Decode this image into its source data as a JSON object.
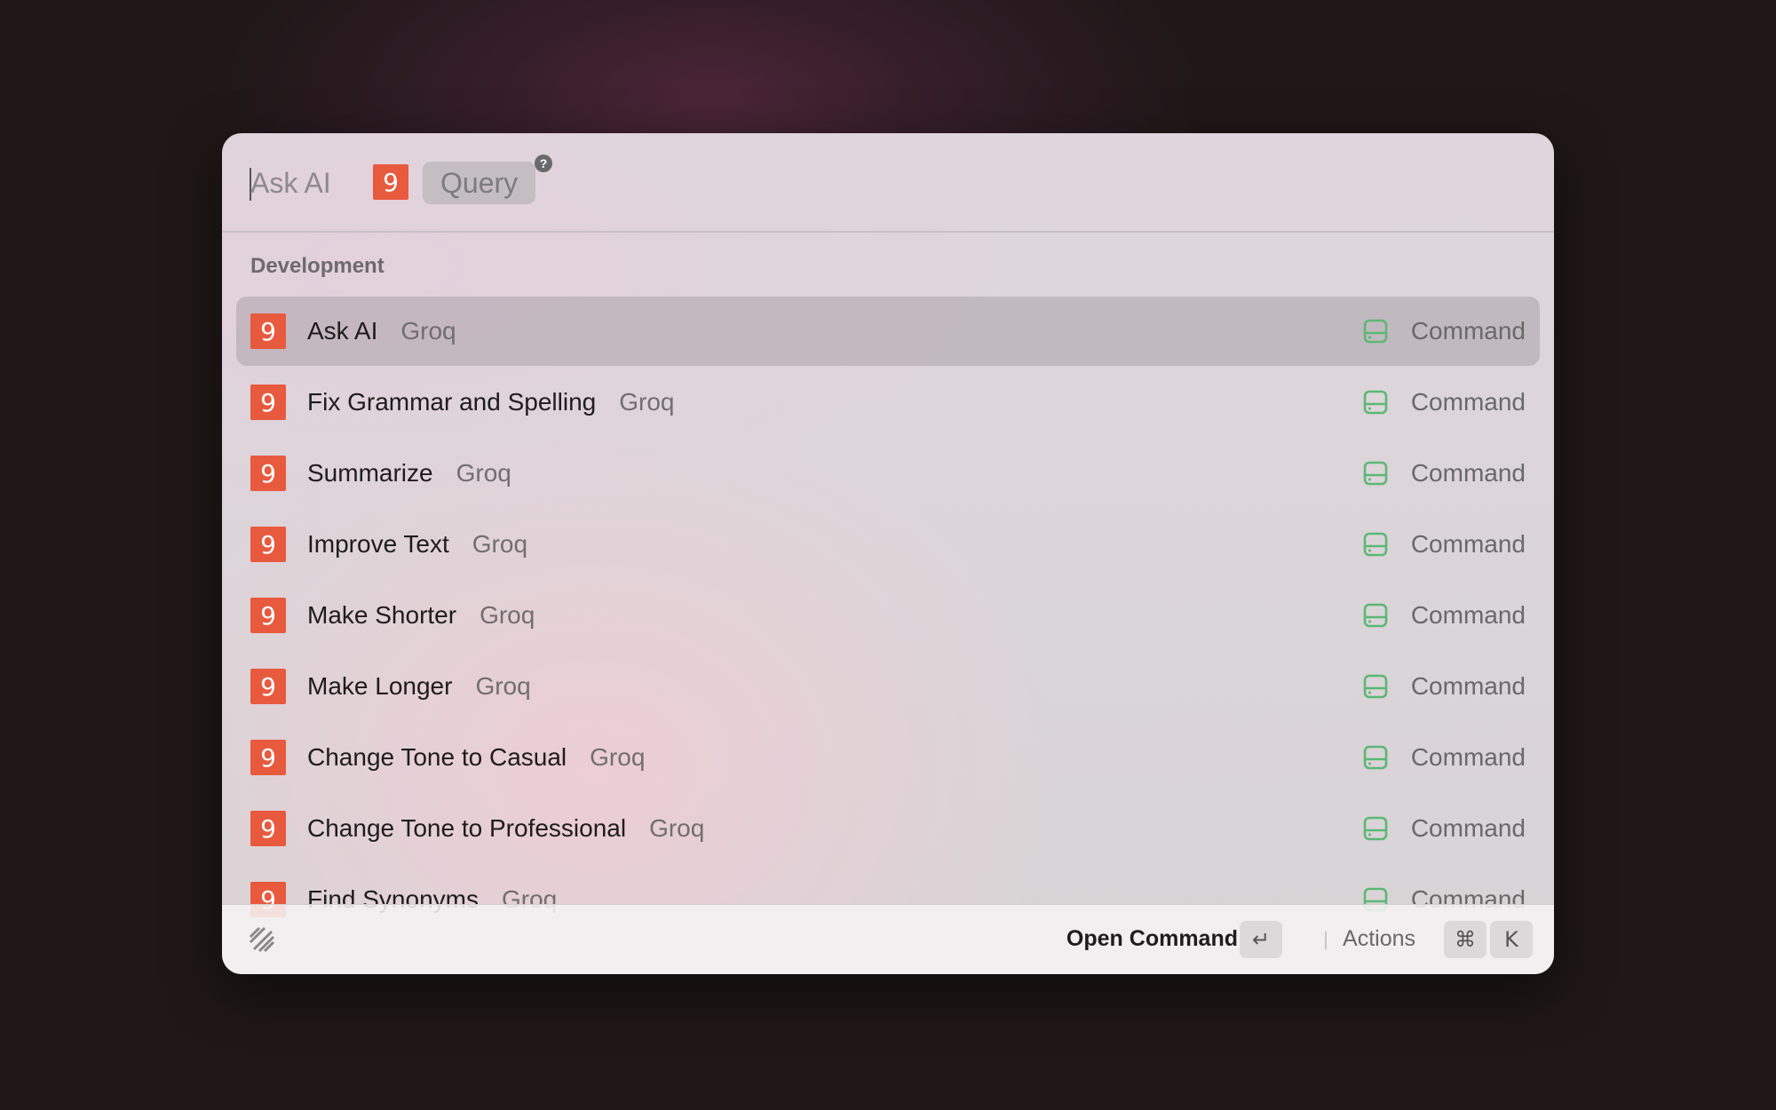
{
  "search": {
    "placeholder": "Ask AI",
    "extension_badge": "9",
    "argument_placeholder": "Query",
    "help_glyph": "?"
  },
  "section": {
    "title": "Development"
  },
  "items": [
    {
      "title": "Ask AI",
      "subtitle": "Groq",
      "type": "Command",
      "icon": "groq-icon",
      "selected": true
    },
    {
      "title": "Fix Grammar and Spelling",
      "subtitle": "Groq",
      "type": "Command",
      "icon": "groq-icon"
    },
    {
      "title": "Summarize",
      "subtitle": "Groq",
      "type": "Command",
      "icon": "groq-icon"
    },
    {
      "title": "Improve Text",
      "subtitle": "Groq",
      "type": "Command",
      "icon": "groq-icon"
    },
    {
      "title": "Make Shorter",
      "subtitle": "Groq",
      "type": "Command",
      "icon": "groq-icon"
    },
    {
      "title": "Make Longer",
      "subtitle": "Groq",
      "type": "Command",
      "icon": "groq-icon"
    },
    {
      "title": "Change Tone to Casual",
      "subtitle": "Groq",
      "type": "Command",
      "icon": "groq-icon"
    },
    {
      "title": "Change Tone to Professional",
      "subtitle": "Groq",
      "type": "Command",
      "icon": "groq-icon"
    },
    {
      "title": "Find Synonyms",
      "subtitle": "Groq",
      "type": "Command",
      "icon": "groq-icon"
    }
  ],
  "footer": {
    "primary_action": "Open Command",
    "enter_key": "↵",
    "actions_label": "Actions",
    "cmd_key": "⌘",
    "k_key": "K"
  },
  "colors": {
    "groq_brand": "#e85a3e",
    "command_icon": "#5cb874",
    "selected_row": "#b8aeb6"
  }
}
